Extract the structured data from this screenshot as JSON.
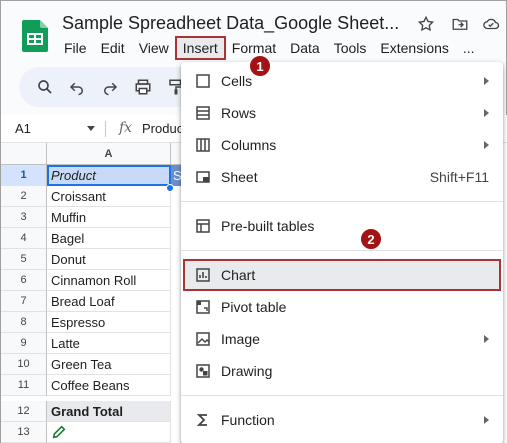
{
  "document": {
    "title": "Sample Spreadheet Data_Google Sheet..."
  },
  "menubar": {
    "items": [
      "File",
      "Edit",
      "View",
      "Insert",
      "Format",
      "Data",
      "Tools",
      "Extensions",
      "..."
    ]
  },
  "header_icons": [
    "star-icon",
    "move-to-folder-icon",
    "cloud-status-icon"
  ],
  "toolbar": {
    "icons": [
      "search-icon",
      "undo-icon",
      "redo-icon",
      "print-icon",
      "paint-format-icon"
    ]
  },
  "formula_bar": {
    "name_box": "A1",
    "fx_label": "fx",
    "content": "Product"
  },
  "grid": {
    "column_header": "A",
    "next_column_preview": "S",
    "rows": [
      {
        "num": "1",
        "value": "Product"
      },
      {
        "num": "2",
        "value": "Croissant"
      },
      {
        "num": "3",
        "value": "Muffin"
      },
      {
        "num": "4",
        "value": "Bagel"
      },
      {
        "num": "5",
        "value": "Donut"
      },
      {
        "num": "6",
        "value": "Cinnamon Roll"
      },
      {
        "num": "7",
        "value": "Bread Loaf"
      },
      {
        "num": "8",
        "value": "Espresso"
      },
      {
        "num": "9",
        "value": "Latte"
      },
      {
        "num": "10",
        "value": "Green Tea"
      },
      {
        "num": "11",
        "value": "Coffee Beans"
      },
      {
        "num": "12",
        "value": "Grand Total"
      },
      {
        "num": "13",
        "value": ""
      }
    ]
  },
  "insert_menu": {
    "cells": "Cells",
    "rows": "Rows",
    "columns": "Columns",
    "sheet": "Sheet",
    "sheet_shortcut": "Shift+F11",
    "prebuilt_tables": "Pre-built tables",
    "chart": "Chart",
    "pivot_table": "Pivot table",
    "image": "Image",
    "drawing": "Drawing",
    "function": "Function"
  },
  "badges": {
    "step1": "1",
    "step2": "2"
  },
  "colors": {
    "accent": "#1a73e8",
    "highlight_outline": "#a33333",
    "badge": "#a31313",
    "sheets_green": "#0f9d58"
  }
}
